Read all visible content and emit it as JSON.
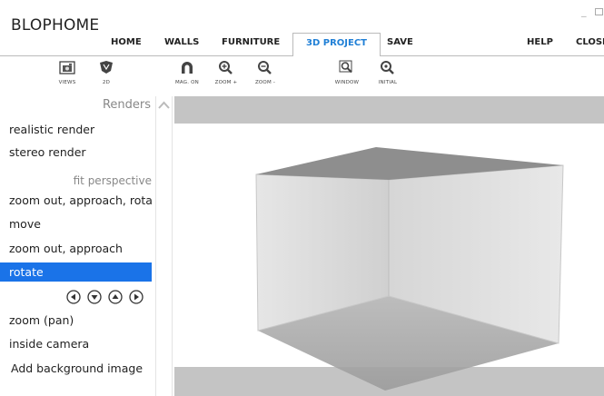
{
  "app": {
    "title": "BLOPHOME"
  },
  "menu": {
    "home": "HOME",
    "walls": "WALLS",
    "furniture": "FURNITURE",
    "project3d": "3D PROJECT",
    "save": "SAVE",
    "help": "HELP",
    "close": "CLOSE"
  },
  "toolbar": {
    "views": "VIEWS",
    "twod": "2D",
    "mag_on": "MAG. ON",
    "zoom_in": "ZOOM +",
    "zoom_out": "ZOOM -",
    "window": "WINDOW",
    "initial": "INITIAL"
  },
  "sidebar": {
    "header": "Renders",
    "items": [
      "realistic render",
      "stereo render",
      "fit perspective",
      "zoom out, approach, rota",
      "move",
      "zoom out, approach",
      "rotate",
      "zoom (pan)",
      "inside camera",
      "Add background image"
    ],
    "selected": "rotate"
  },
  "colors": {
    "accent": "#1f7fd6",
    "selection": "#1a73e8",
    "viewport_band": "#c4c4c4"
  }
}
